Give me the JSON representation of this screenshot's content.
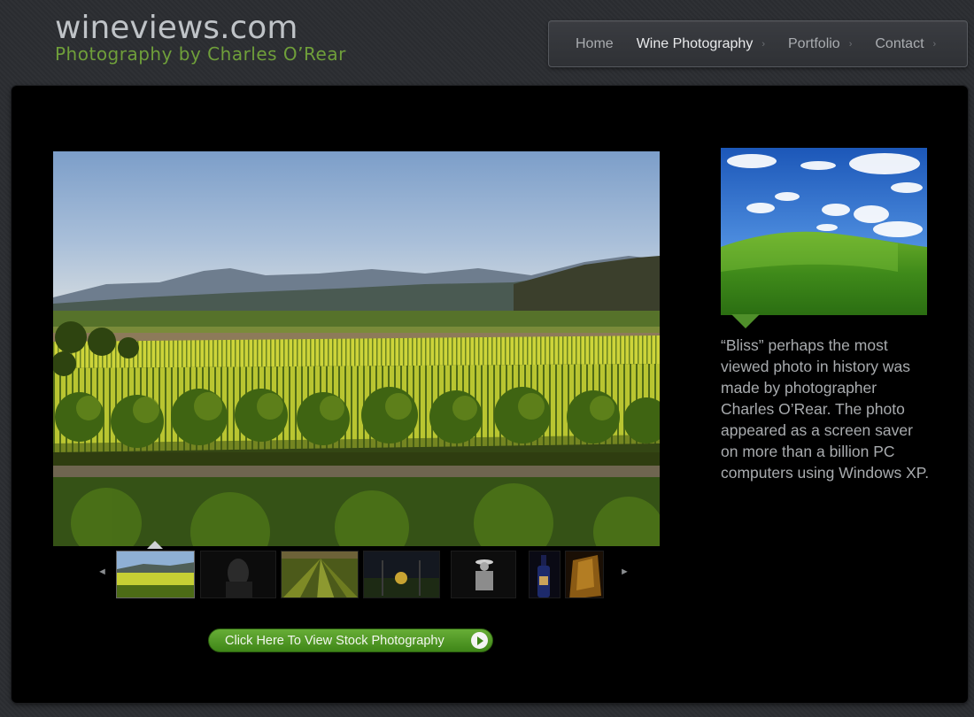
{
  "brand": {
    "title": "wineviews.com",
    "subtitle": "Photography by Charles O’Rear"
  },
  "nav": {
    "items": [
      {
        "label": "Home",
        "has_submenu": false,
        "active": false
      },
      {
        "label": "Wine Photography",
        "has_submenu": true,
        "active": true
      },
      {
        "label": "Portfolio",
        "has_submenu": true,
        "active": false
      },
      {
        "label": "Contact",
        "has_submenu": true,
        "active": false
      }
    ],
    "chevron": "›"
  },
  "gallery": {
    "main_photo": "vineyard-landscape",
    "prev_arrow": "◄",
    "next_arrow": "►",
    "thumbnails": [
      {
        "subject": "vineyard-landscape",
        "selected": true
      },
      {
        "subject": "dark-portrait",
        "selected": false
      },
      {
        "subject": "vineyard-rows",
        "selected": false
      },
      {
        "subject": "vineyard-night",
        "selected": false
      },
      {
        "subject": "man-in-hat",
        "selected": false
      },
      {
        "subject": "wine-bottle",
        "selected": false
      },
      {
        "subject": "wine-glass",
        "selected": false
      }
    ]
  },
  "stock_button": {
    "label": "Click Here To View Stock Photography"
  },
  "bliss": {
    "photo": "bliss-green-hill",
    "caption": "“Bliss” perhaps the most viewed photo in history was made by photographer Charles O’Rear. The photo appeared as a screen saver on more than a billion PC computers using Windows XP."
  },
  "colors": {
    "background": "#2b2d31",
    "panel": "#000000",
    "accent_green": "#6f9f3a",
    "button_green": "#4f9a24",
    "text_muted": "#a8abae"
  }
}
